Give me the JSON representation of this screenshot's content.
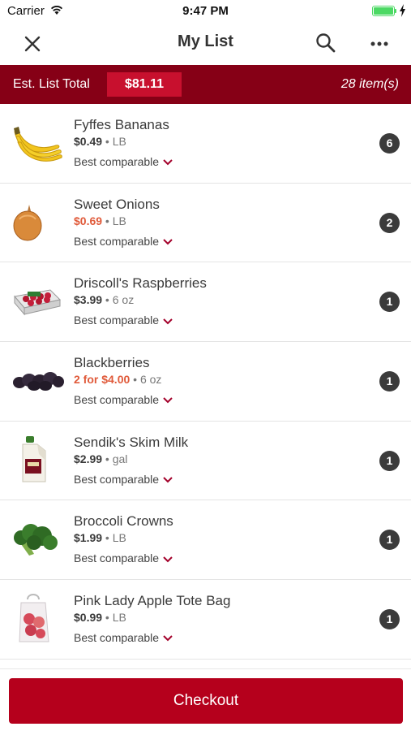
{
  "status": {
    "carrier": "Carrier",
    "time": "9:47 PM",
    "battery_level": 1.0
  },
  "nav": {
    "title": "My List",
    "close_icon": "close-icon",
    "search_icon": "search-icon",
    "more_icon": "more-icon"
  },
  "summary": {
    "label": "Est. List Total",
    "total": "$81.11",
    "count": "28 item(s)"
  },
  "items": [
    {
      "name": "Fyffes Bananas",
      "price": "$0.49",
      "price_sale": false,
      "unit": "LB",
      "comparable": "Best comparable",
      "qty": "6",
      "thumb": "bananas"
    },
    {
      "name": "Sweet Onions",
      "price": "$0.69",
      "price_sale": true,
      "unit": "LB",
      "comparable": "Best comparable",
      "qty": "2",
      "thumb": "onion"
    },
    {
      "name": "Driscoll's Raspberries",
      "price": "$3.99",
      "price_sale": false,
      "unit": "6 oz",
      "comparable": "Best comparable",
      "qty": "1",
      "thumb": "raspberries"
    },
    {
      "name": "Blackberries",
      "price": "2 for $4.00",
      "price_sale": true,
      "unit": "6 oz",
      "comparable": "Best comparable",
      "qty": "1",
      "thumb": "blackberries"
    },
    {
      "name": "Sendik's Skim Milk",
      "price": "$2.99",
      "price_sale": false,
      "unit": "gal",
      "comparable": "Best comparable",
      "qty": "1",
      "thumb": "milk"
    },
    {
      "name": "Broccoli Crowns",
      "price": "$1.99",
      "price_sale": false,
      "unit": "LB",
      "comparable": "Best comparable",
      "qty": "1",
      "thumb": "broccoli"
    },
    {
      "name": "Pink Lady Apple Tote Bag",
      "price": "$0.99",
      "price_sale": false,
      "unit": "LB",
      "comparable": "Best comparable",
      "qty": "1",
      "thumb": "apple-bag"
    }
  ],
  "checkout": {
    "label": "Checkout"
  },
  "colors": {
    "brand_dark": "#860016",
    "brand": "#c8102e",
    "checkout": "#b5001c",
    "sale": "#e05a3a"
  }
}
